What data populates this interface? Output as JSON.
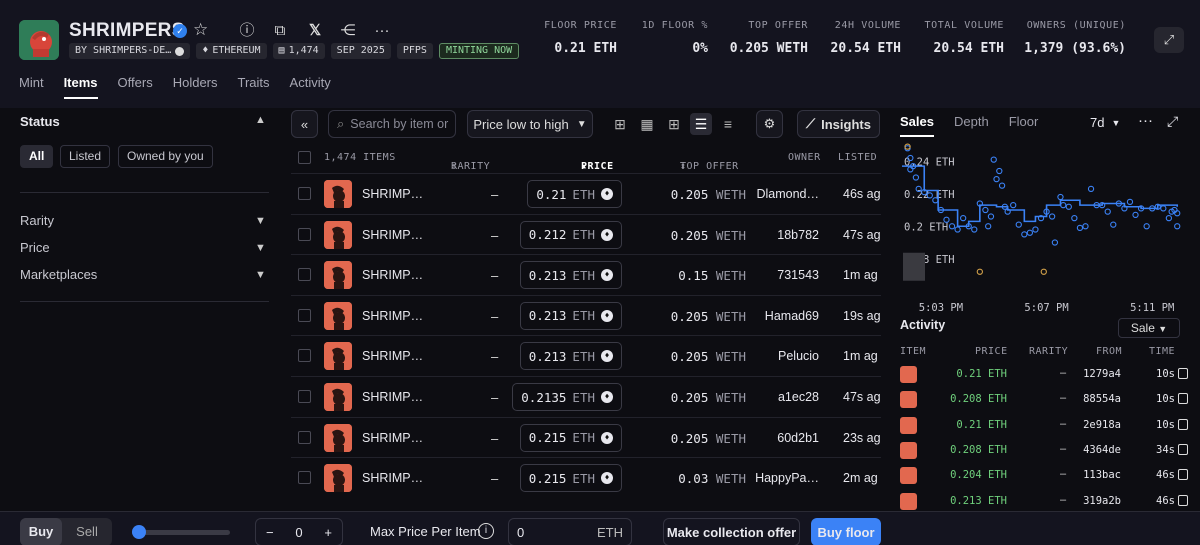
{
  "collection": {
    "title": "SHRIMPERS",
    "creator": "BY SHRIMPERS-DE…",
    "chain": "ETHEREUM",
    "supply": "1,474",
    "date": "SEP 2025",
    "symbol": "PFPS",
    "mint_status": "MINTING NOW"
  },
  "stats": [
    {
      "label": "FLOOR PRICE",
      "value": "0.21 ETH"
    },
    {
      "label": "1D FLOOR %",
      "value": "0%"
    },
    {
      "label": "TOP OFFER",
      "value": "0.205 WETH"
    },
    {
      "label": "24H VOLUME",
      "value": "20.54 ETH"
    },
    {
      "label": "TOTAL VOLUME",
      "value": "20.54 ETH"
    },
    {
      "label": "OWNERS (UNIQUE)",
      "value": "1,379 (93.6%)"
    }
  ],
  "nav_tabs": [
    "Mint",
    "Items",
    "Offers",
    "Holders",
    "Traits",
    "Activity"
  ],
  "filters": {
    "status_title": "Status",
    "status_pills": [
      "All",
      "Listed",
      "Owned by you"
    ],
    "sections": [
      "Rarity",
      "Price",
      "Marketplaces"
    ]
  },
  "toolbar": {
    "search_placeholder": "Search by item or",
    "sort": "Price low to high",
    "insights": "Insights"
  },
  "table": {
    "headers": {
      "items": "1,474 ITEMS",
      "rarity": "RARITY",
      "price": "PRICE",
      "top_offer": "TOP OFFER",
      "owner": "OWNER",
      "listed": "LISTED"
    },
    "rows": [
      {
        "name": "SHRIMP…",
        "rarity": "–",
        "price": "0.21",
        "price_unit": "ETH",
        "offer": "0.205",
        "offer_unit": "WETH",
        "owner": "Dlamond…",
        "listed": "46s ag"
      },
      {
        "name": "SHRIMP…",
        "rarity": "–",
        "price": "0.212",
        "price_unit": "ETH",
        "offer": "0.205",
        "offer_unit": "WETH",
        "owner": "18b782",
        "listed": "47s ag"
      },
      {
        "name": "SHRIMP…",
        "rarity": "–",
        "price": "0.213",
        "price_unit": "ETH",
        "offer": "0.15",
        "offer_unit": "WETH",
        "owner": "731543",
        "listed": "1m ag"
      },
      {
        "name": "SHRIMP…",
        "rarity": "–",
        "price": "0.213",
        "price_unit": "ETH",
        "offer": "0.205",
        "offer_unit": "WETH",
        "owner": "Hamad69",
        "listed": "19s ag"
      },
      {
        "name": "SHRIMP…",
        "rarity": "–",
        "price": "0.213",
        "price_unit": "ETH",
        "offer": "0.205",
        "offer_unit": "WETH",
        "owner": "Pelucio",
        "listed": "1m ag"
      },
      {
        "name": "SHRIMP…",
        "rarity": "–",
        "price": "0.2135",
        "price_unit": "ETH",
        "offer": "0.205",
        "offer_unit": "WETH",
        "owner": "a1ec28",
        "listed": "47s ag"
      },
      {
        "name": "SHRIMP…",
        "rarity": "–",
        "price": "0.215",
        "price_unit": "ETH",
        "offer": "0.205",
        "offer_unit": "WETH",
        "owner": "60d2b1",
        "listed": "23s ag"
      },
      {
        "name": "SHRIMP…",
        "rarity": "–",
        "price": "0.215",
        "price_unit": "ETH",
        "offer": "0.03",
        "offer_unit": "WETH",
        "owner": "HappyPa…",
        "listed": "2m ag"
      }
    ]
  },
  "panel": {
    "tabs": [
      "Sales",
      "Depth",
      "Floor"
    ],
    "range": "7d",
    "activity_title": "Activity",
    "activity_filter": "Sale",
    "activity_headers": {
      "item": "ITEM",
      "price": "PRICE",
      "rarity": "RARITY",
      "from": "FROM",
      "time": "TIME"
    },
    "activity": [
      {
        "price": "0.21 ETH",
        "rarity": "–",
        "from": "1279a4",
        "time": "10s"
      },
      {
        "price": "0.208 ETH",
        "rarity": "–",
        "from": "88554a",
        "time": "10s"
      },
      {
        "price": "0.21 ETH",
        "rarity": "–",
        "from": "2e918a",
        "time": "10s"
      },
      {
        "price": "0.208 ETH",
        "rarity": "–",
        "from": "4364de",
        "time": "34s"
      },
      {
        "price": "0.204 ETH",
        "rarity": "–",
        "from": "113bac",
        "time": "46s"
      },
      {
        "price": "0.213 ETH",
        "rarity": "–",
        "from": "319a2b",
        "time": "46s"
      }
    ]
  },
  "chart_data": {
    "type": "scatter",
    "y_tick_labels": [
      "0.24 ETH",
      "0.22 ETH",
      "0.2 ETH",
      "0.18 ETH"
    ],
    "x_tick_labels": [
      "5:03 PM",
      "5:07 PM",
      "5:11 PM"
    ],
    "ylim": [
      0.17,
      0.25
    ],
    "xlim": [
      0,
      100
    ],
    "point_color": "#3b82f6",
    "floor_line_color": "#3b82f6",
    "points": [
      [
        2,
        0.248
      ],
      [
        3,
        0.235
      ],
      [
        3,
        0.242
      ],
      [
        4,
        0.237
      ],
      [
        5,
        0.23
      ],
      [
        6,
        0.223
      ],
      [
        8,
        0.221
      ],
      [
        10,
        0.219
      ],
      [
        12,
        0.216
      ],
      [
        14,
        0.21
      ],
      [
        16,
        0.204
      ],
      [
        18,
        0.2
      ],
      [
        20,
        0.198
      ],
      [
        22,
        0.205
      ],
      [
        24,
        0.2
      ],
      [
        26,
        0.198
      ],
      [
        28,
        0.214
      ],
      [
        30,
        0.21
      ],
      [
        31,
        0.2
      ],
      [
        32,
        0.206
      ],
      [
        33,
        0.241
      ],
      [
        34,
        0.229
      ],
      [
        35,
        0.234
      ],
      [
        36,
        0.225
      ],
      [
        37,
        0.212
      ],
      [
        38,
        0.209
      ],
      [
        40,
        0.213
      ],
      [
        42,
        0.201
      ],
      [
        44,
        0.195
      ],
      [
        46,
        0.196
      ],
      [
        48,
        0.198
      ],
      [
        50,
        0.205
      ],
      [
        52,
        0.209
      ],
      [
        54,
        0.206
      ],
      [
        55,
        0.19
      ],
      [
        57,
        0.218
      ],
      [
        58,
        0.213
      ],
      [
        60,
        0.212
      ],
      [
        62,
        0.205
      ],
      [
        64,
        0.199
      ],
      [
        66,
        0.2
      ],
      [
        68,
        0.223
      ],
      [
        70,
        0.213
      ],
      [
        72,
        0.213
      ],
      [
        74,
        0.209
      ],
      [
        76,
        0.201
      ],
      [
        78,
        0.214
      ],
      [
        80,
        0.211
      ],
      [
        82,
        0.215
      ],
      [
        84,
        0.207
      ],
      [
        86,
        0.211
      ],
      [
        88,
        0.2
      ],
      [
        90,
        0.211
      ],
      [
        92,
        0.212
      ],
      [
        94,
        0.211
      ],
      [
        96,
        0.205
      ],
      [
        97,
        0.209
      ],
      [
        98,
        0.21
      ],
      [
        99,
        0.2
      ],
      [
        99,
        0.208
      ]
    ],
    "floor_line": [
      [
        0,
        0.237
      ],
      [
        8,
        0.222
      ],
      [
        13,
        0.21
      ],
      [
        20,
        0.2
      ],
      [
        24,
        0.203
      ],
      [
        28,
        0.213
      ],
      [
        34,
        0.212
      ],
      [
        38,
        0.21
      ],
      [
        44,
        0.203
      ],
      [
        48,
        0.206
      ],
      [
        52,
        0.213
      ],
      [
        57,
        0.216
      ],
      [
        64,
        0.213
      ],
      [
        72,
        0.214
      ],
      [
        80,
        0.212
      ],
      [
        86,
        0.211
      ],
      [
        92,
        0.213
      ],
      [
        99,
        0.212
      ]
    ],
    "highlight_points": [
      [
        2,
        0.249
      ],
      [
        28,
        0.172
      ],
      [
        51,
        0.172
      ]
    ],
    "highlight_color": "#d4a24a"
  },
  "bottom_bar": {
    "buy": "Buy",
    "sell": "Sell",
    "quantity": "0",
    "max_price_label": "Max Price Per Item",
    "max_price_value": "0",
    "max_price_unit": "ETH",
    "offer_button": "Make collection offer",
    "buy_floor": "Buy floor"
  }
}
